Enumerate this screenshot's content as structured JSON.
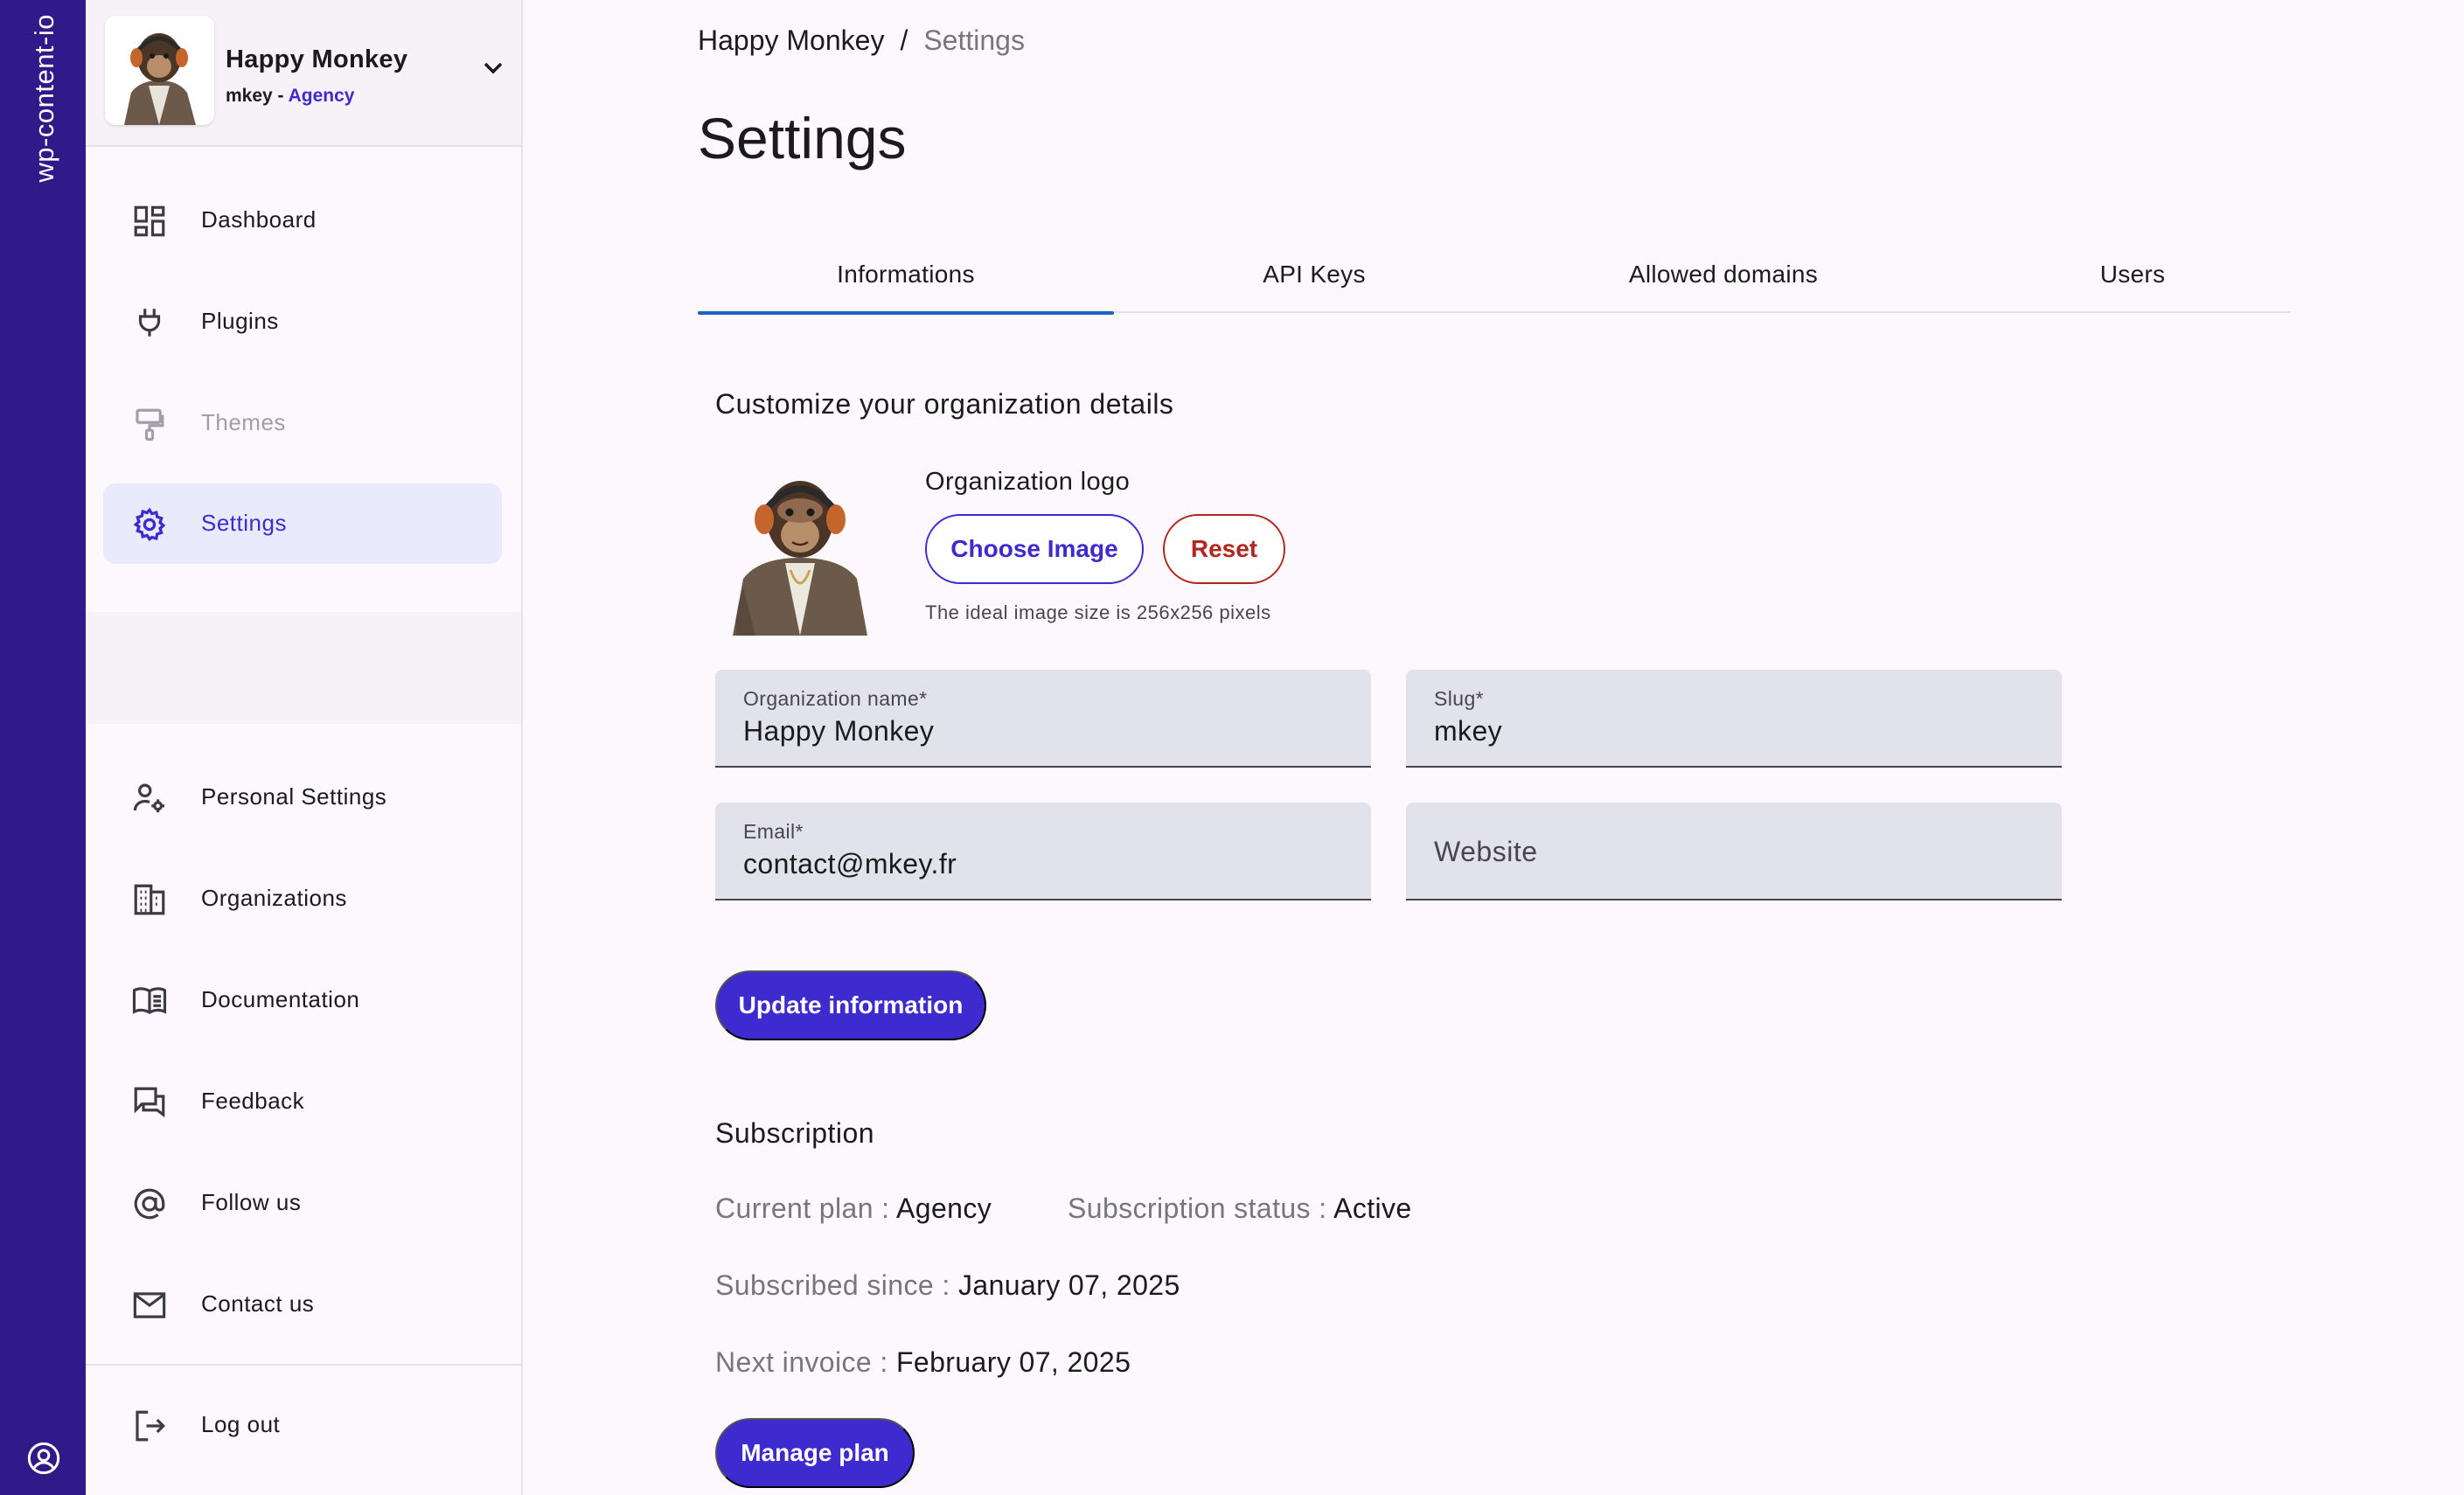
{
  "brand": "wp-content-io",
  "org": {
    "name": "Happy Monkey",
    "slug": "mkey",
    "separator": " - ",
    "plan": "Agency"
  },
  "nav": {
    "dashboard": "Dashboard",
    "plugins": "Plugins",
    "themes": "Themes",
    "settings": "Settings",
    "personal_settings": "Personal Settings",
    "organizations": "Organizations",
    "documentation": "Documentation",
    "feedback": "Feedback",
    "follow_us": "Follow us",
    "contact_us": "Contact us",
    "log_out": "Log out"
  },
  "breadcrumb": {
    "org": "Happy Monkey",
    "separator": "/",
    "current": "Settings"
  },
  "page_title": "Settings",
  "tabs": {
    "informations": "Informations",
    "api_keys": "API Keys",
    "allowed_domains": "Allowed domains",
    "users": "Users"
  },
  "details": {
    "title": "Customize your organization details",
    "logo_label": "Organization logo",
    "choose_image": "Choose Image",
    "reset": "Reset",
    "hint": "The ideal image size is 256x256 pixels",
    "name_label": "Organization name*",
    "name_value": "Happy Monkey",
    "slug_label": "Slug*",
    "slug_value": "mkey",
    "email_label": "Email*",
    "email_value": "contact@mkey.fr",
    "website_placeholder": "Website",
    "update_button": "Update information"
  },
  "subscription": {
    "title": "Subscription",
    "current_plan_label": "Current plan : ",
    "current_plan_value": "Agency",
    "status_label": "Subscription status : ",
    "status_value": "Active",
    "since_label": "Subscribed since : ",
    "since_value": "January 07, 2025",
    "next_invoice_label": "Next invoice : ",
    "next_invoice_value": "February 07, 2025",
    "manage_button": "Manage plan"
  },
  "colors": {
    "rail": "#2f1a8a",
    "primary": "#3d2bcf",
    "danger": "#b3261e",
    "active_nav_bg": "#e9eafc",
    "tab_indicator": "#1f63c2"
  }
}
